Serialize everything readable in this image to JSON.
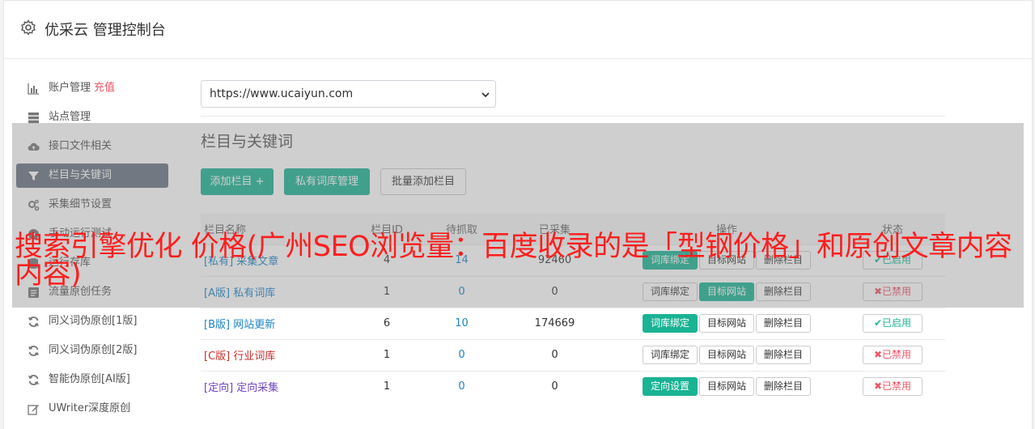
{
  "header": {
    "title": "优采云 管理控制台",
    "icon": "gear-icon"
  },
  "sidebar": {
    "items": [
      {
        "label": "账户管理",
        "extra": "充值",
        "icon": "bar-chart-icon"
      },
      {
        "label": "站点管理",
        "icon": "server-icon"
      },
      {
        "label": "接口文件相关",
        "icon": "cloud-upload-icon"
      },
      {
        "label": "栏目与关键词",
        "icon": "filter-icon",
        "active": true
      },
      {
        "label": "采集细节设置",
        "icon": "cogs-icon"
      },
      {
        "label": "手动运行测试",
        "icon": "play-icon"
      },
      {
        "label": "运行存库",
        "icon": "database-icon"
      },
      {
        "label": "流量原创任务",
        "icon": "tasks-icon"
      },
      {
        "label": "同义词伪原创[1版]",
        "icon": "refresh-icon"
      },
      {
        "label": "同义词伪原创[2版]",
        "icon": "refresh-icon"
      },
      {
        "label": "智能伪原创[AI版]",
        "icon": "refresh-icon"
      },
      {
        "label": "UWriter深度原创",
        "icon": "edit-icon"
      }
    ]
  },
  "site_select": {
    "value": "https://www.ucaiyun.com"
  },
  "section": {
    "title": "栏目与关键词",
    "add_button": "添加栏目 +",
    "private_lib_button": "私有词库管理",
    "batch_add_button": "批量添加栏目"
  },
  "table": {
    "headers": [
      "栏目名称",
      "栏目ID",
      "待抓取",
      "已采集",
      "操作",
      "状态"
    ],
    "rows": [
      {
        "tag": "[私有]",
        "name": "采集文章",
        "id": "4",
        "pending": "14",
        "done": "92460",
        "op1": "词库绑定",
        "op2": "目标网站",
        "op3": "删除栏目",
        "status": "已启用"
      },
      {
        "tag": "[A版]",
        "name": "私有词库",
        "id": "1",
        "pending": "0",
        "done": "0",
        "op1": "词库绑定",
        "op2": "目标网站",
        "op3": "删除栏目",
        "status": "已禁用"
      },
      {
        "tag": "[B版]",
        "name": "网站更新",
        "id": "6",
        "pending": "10",
        "done": "174669",
        "op1": "词库绑定",
        "op2": "目标网站",
        "op3": "删除栏目",
        "status": "已启用"
      },
      {
        "tag": "[C版]",
        "name": "行业词库",
        "id": "1",
        "pending": "0",
        "done": "0",
        "op1": "词库绑定",
        "op2": "目标网站",
        "op3": "删除栏目",
        "status": "已禁用"
      },
      {
        "tag": "[定向]",
        "name": "定向采集",
        "id": "1",
        "pending": "0",
        "done": "0",
        "op1": "定向设置",
        "op2": "目标网站",
        "op3": "删除栏目",
        "status": "已禁用"
      }
    ]
  },
  "overlay": {
    "text": "搜索引擎优化 价格(广州SEO浏览量：百度收录的是「型钢价格」和原创文章内容内容)"
  },
  "colors": {
    "accent": "#1ab394",
    "danger": "#ed5565",
    "link": "#1c84c6",
    "overlay_text": "#ff1e1e"
  }
}
